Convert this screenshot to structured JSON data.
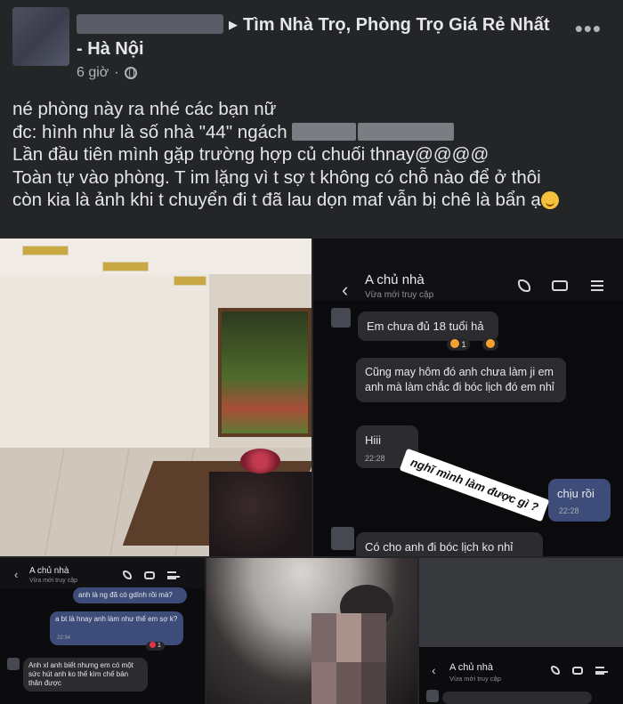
{
  "post": {
    "group_name": "Tìm Nhà Trọ, Phòng Trọ Giá Rẻ Nhất - Hà Nội",
    "group_name_line1": "Tìm Nhà Trọ, Phòng Trọ Giá Rẻ Nhất",
    "group_name_line2": "- Hà Nội",
    "time": "6 giờ",
    "time_separator": "·",
    "more_icon": "more-dots-icon",
    "body_lines": [
      "né phòng này ra nhé các bạn nữ",
      "đc: hình như là số nhà \"44\" ngách",
      "Lần đầu tiên mình gặp trường hợp củ chuối thnay@@@@",
      "Toàn tự vào phòng. T im lặng vì t sợ t không có chỗ nào để ở thôi",
      "còn kia là ảnh khi t chuyển đi t đã lau dọn maf vẫn bị chê là bẩn ạ"
    ]
  },
  "chat1": {
    "contact_name": "A chủ nhà",
    "status": "Vừa mới truy cập",
    "messages": [
      {
        "text": "Em chưa đủ 18 tuổi hả",
        "side": "left"
      },
      {
        "text": "Cũng may hôm đó anh chưa làm ji em anh mà làm chắc đi bóc lịch đó em nhỉ",
        "side": "left"
      },
      {
        "text": "Hiii",
        "side": "left",
        "time": "22:28"
      },
      {
        "text": "chịu rồi",
        "side": "right",
        "time": "22:28"
      },
      {
        "text": "Có cho anh đi bóc lịch ko nhỉ",
        "side": "left"
      }
    ],
    "reaction_count": "1",
    "sticker": "nghĩ mình làm được gì ?"
  },
  "chat2": {
    "contact_name": "A chủ nhà",
    "status": "Vừa mới truy cập",
    "messages": [
      {
        "text": "anh là ng đã có gdình rồi mà?",
        "side": "right"
      },
      {
        "text": "a bt là hnay anh làm như thế em sợ k?",
        "side": "right",
        "time": "22:34"
      },
      {
        "text": "Anh xl anh biết nhưng em có một sức hút anh ko thế kìm chế bản thân được",
        "side": "left"
      }
    ],
    "reaction_count": "1"
  },
  "chat3": {
    "contact_name": "A chủ nhà",
    "status": "Vừa mới truy cập"
  }
}
